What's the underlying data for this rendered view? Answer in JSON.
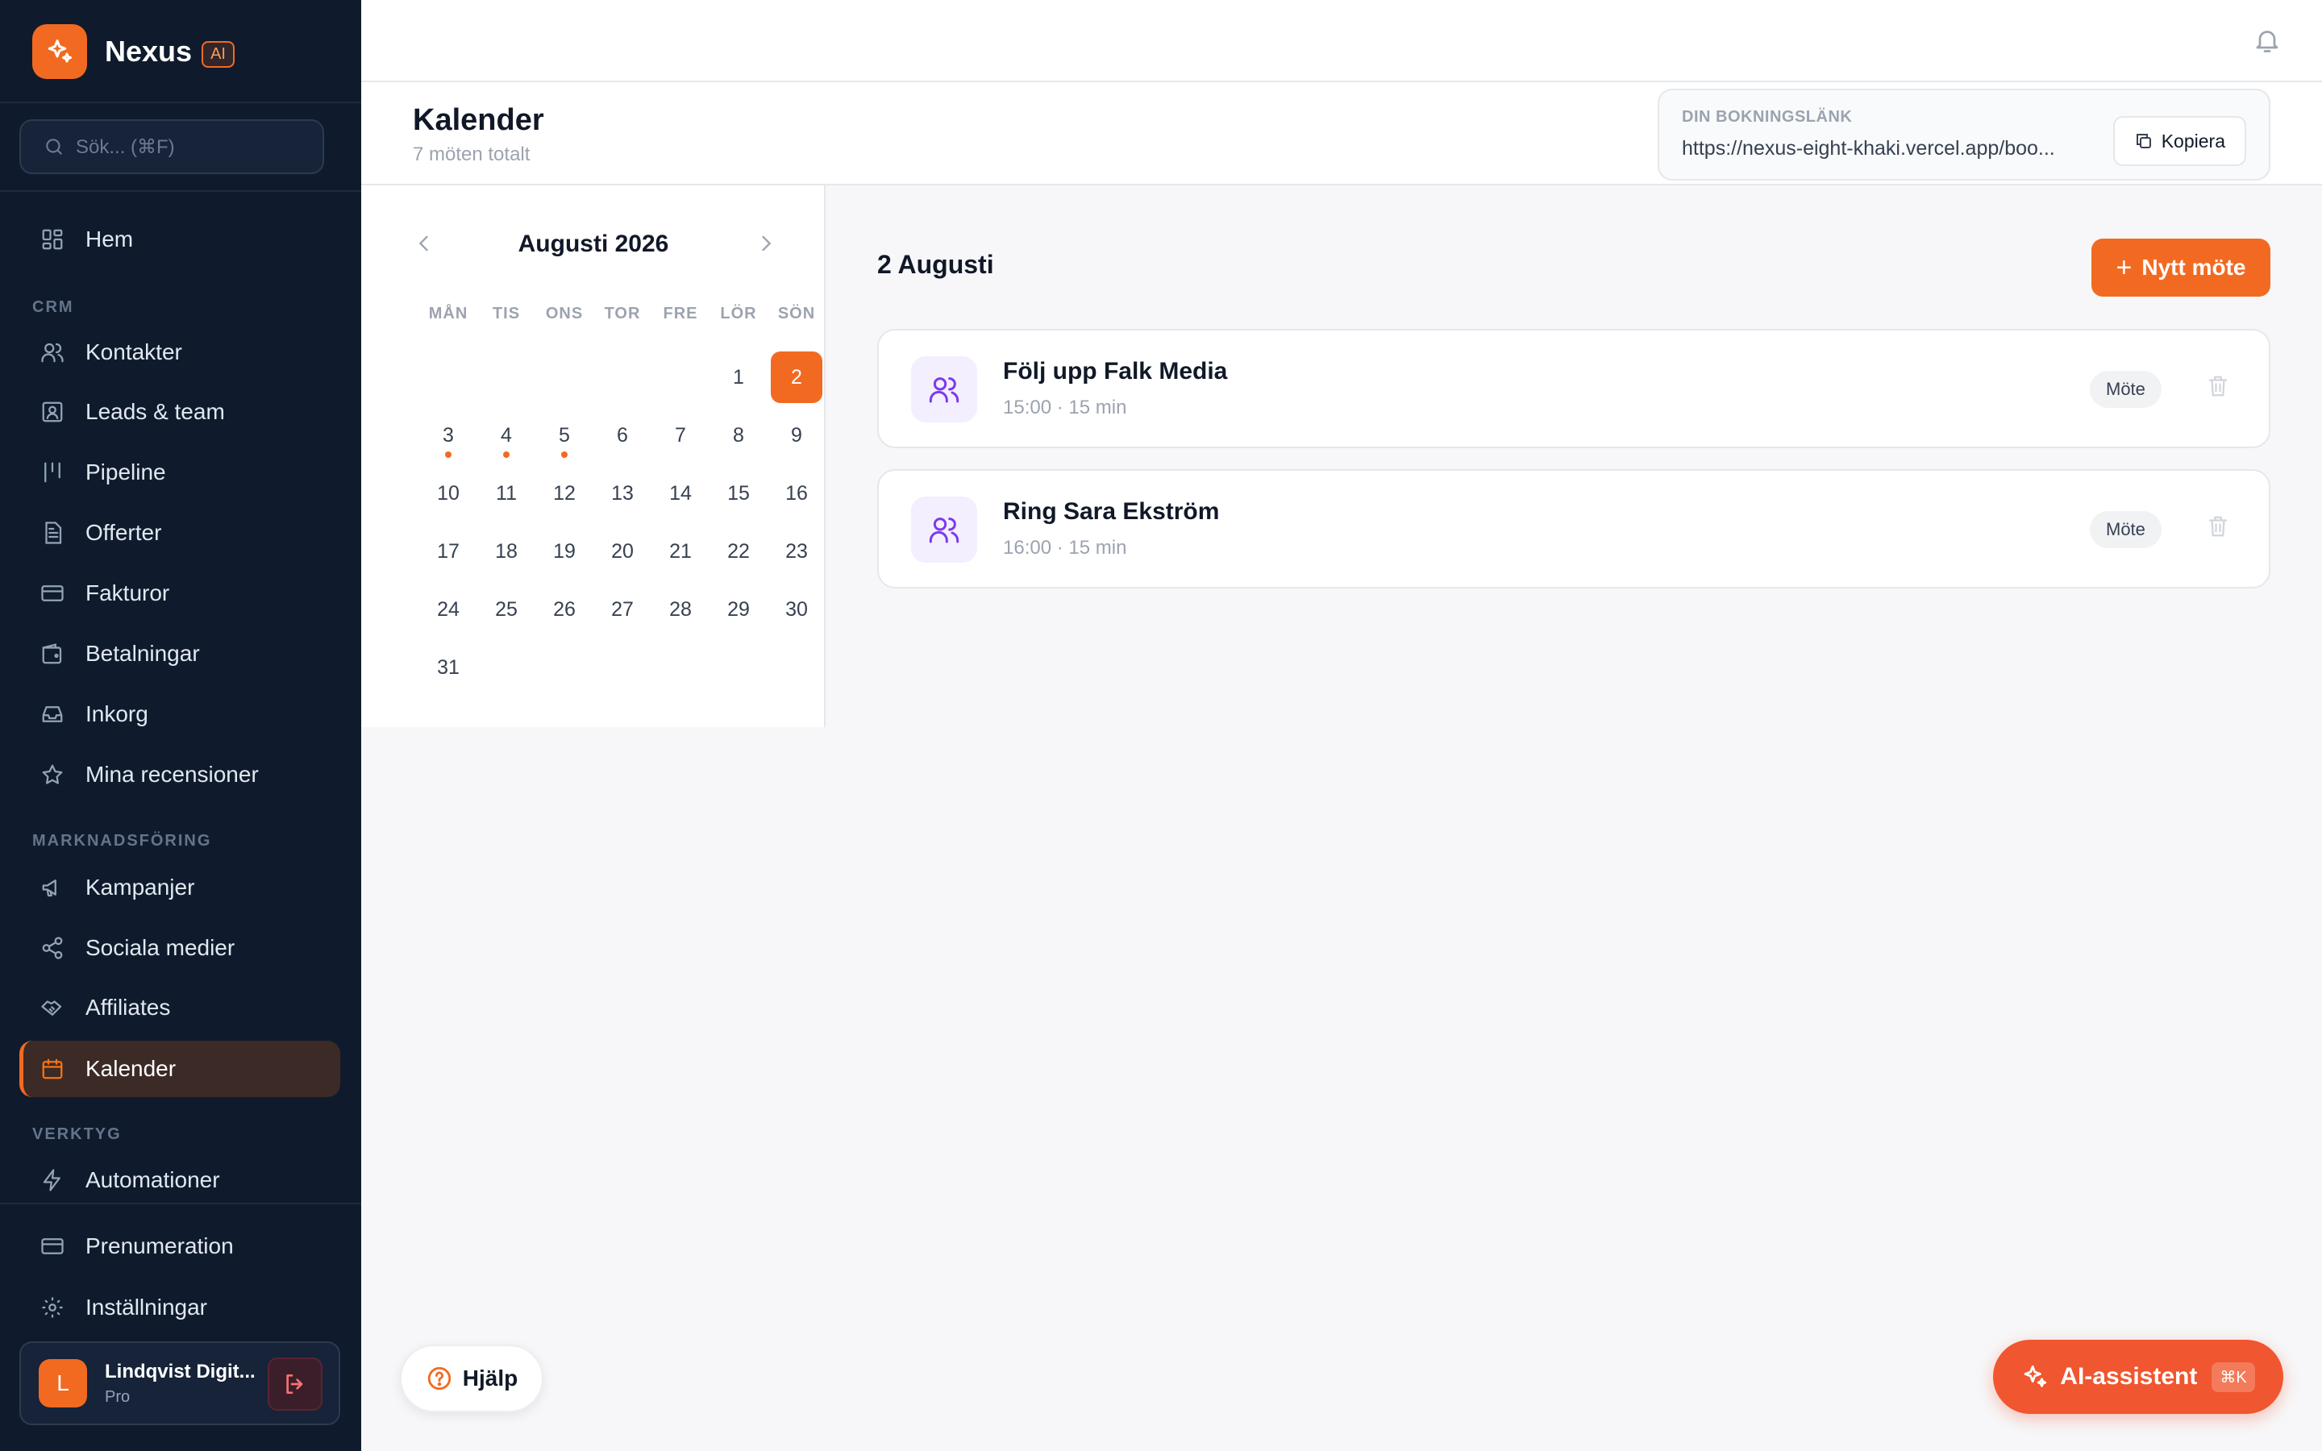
{
  "brand": {
    "name": "Nexus",
    "badge": "AI"
  },
  "search": {
    "placeholder": "Sök... (⌘F)"
  },
  "sidebar": {
    "home": {
      "label": "Hem",
      "icon": "grid-icon"
    },
    "sections": {
      "crm": "CRM",
      "marketing": "MARKNADSFÖRING",
      "tools": "VERKTYG"
    },
    "crm_items": [
      {
        "label": "Kontakter",
        "icon": "users-icon"
      },
      {
        "label": "Leads & team",
        "icon": "contact-card-icon"
      },
      {
        "label": "Pipeline",
        "icon": "pipeline-icon"
      },
      {
        "label": "Offerter",
        "icon": "document-icon"
      },
      {
        "label": "Fakturor",
        "icon": "credit-card-icon"
      },
      {
        "label": "Betalningar",
        "icon": "wallet-icon"
      },
      {
        "label": "Inkorg",
        "icon": "inbox-icon"
      },
      {
        "label": "Mina recensioner",
        "icon": "star-icon"
      }
    ],
    "marketing_items": [
      {
        "label": "Kampanjer",
        "icon": "megaphone-icon"
      },
      {
        "label": "Sociala medier",
        "icon": "share-icon"
      },
      {
        "label": "Affiliates",
        "icon": "handshake-icon"
      },
      {
        "label": "Kalender",
        "icon": "calendar-icon",
        "active": true
      }
    ],
    "tools_items": [
      {
        "label": "Automationer",
        "icon": "lightning-icon"
      }
    ],
    "bottom_items": [
      {
        "label": "Prenumeration",
        "icon": "credit-card-icon"
      },
      {
        "label": "Inställningar",
        "icon": "gear-icon"
      }
    ],
    "user": {
      "initial": "L",
      "name": "Lindqvist Digit...",
      "plan": "Pro"
    }
  },
  "header": {
    "title": "Kalender",
    "subtitle": "7 möten totalt",
    "booking": {
      "label": "DIN BOKNINGSLÄNK",
      "url": "https://nexus-eight-khaki.vercel.app/boo...",
      "copy_label": "Kopiera"
    }
  },
  "calendar": {
    "month_label": "Augusti 2026",
    "weekdays": [
      "MÅN",
      "TIS",
      "ONS",
      "TOR",
      "FRE",
      "LÖR",
      "SÖN"
    ],
    "selected_day": 2,
    "days_with_events": [
      3,
      4,
      5
    ]
  },
  "events_panel": {
    "date_title": "2 Augusti",
    "new_button": "Nytt möte",
    "events": [
      {
        "title": "Följ upp Falk Media",
        "time": "15:00 · 15 min",
        "tag": "Möte"
      },
      {
        "title": "Ring Sara Ekström",
        "time": "16:00 · 15 min",
        "tag": "Möte"
      }
    ]
  },
  "help_button": "Hjälp",
  "ai_button": {
    "label": "AI-assistent",
    "shortcut": "⌘K"
  },
  "colors": {
    "accent": "#f26a21",
    "sidebar_bg": "#0f1b2d",
    "event_icon": "#7c3aed"
  }
}
